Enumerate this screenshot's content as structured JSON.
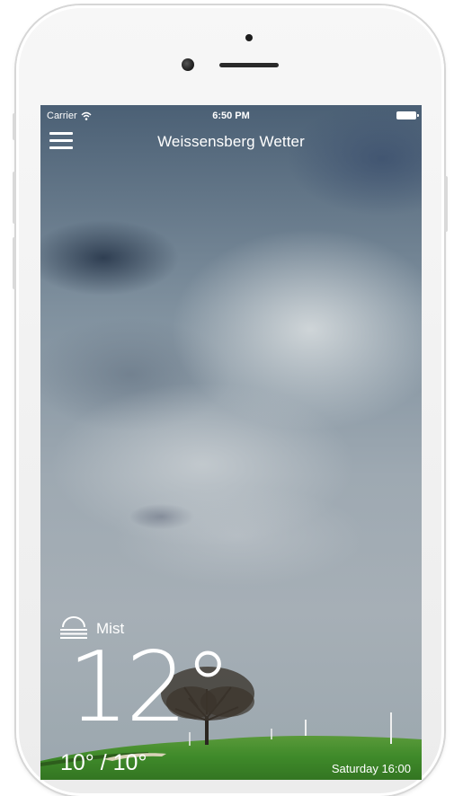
{
  "status_bar": {
    "carrier": "Carrier",
    "time": "6:50 PM",
    "wifi_icon": "wifi-icon",
    "battery_icon": "battery-icon"
  },
  "nav": {
    "title": "Weissensberg Wetter",
    "menu_icon": "hamburger-menu-icon"
  },
  "weather": {
    "condition": "Mist",
    "condition_icon": "mist-icon",
    "temperature": "12°",
    "min_max": "10° / 10°",
    "updated": "Saturday 16:00"
  },
  "colors": {
    "text": "#ffffff",
    "grass": "#3f8a2a",
    "sky_dark": "#4b6075"
  }
}
